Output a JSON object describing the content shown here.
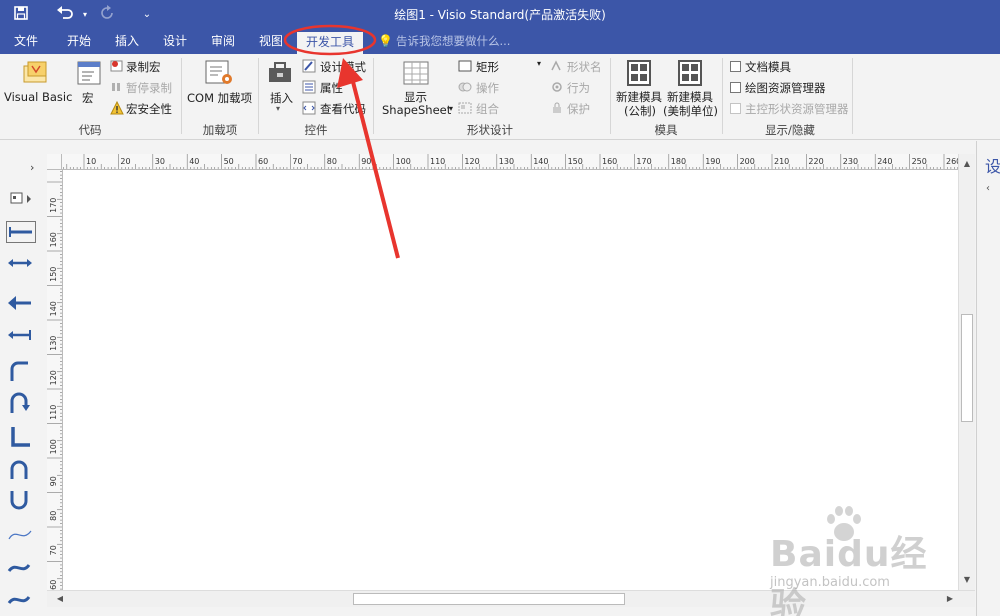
{
  "window": {
    "title": "绘图1 - Visio Standard(产品激活失败)"
  },
  "quick_access": {
    "save": "save-icon",
    "undo": "undo-icon",
    "redo": "redo-icon",
    "customize": "customize-icon"
  },
  "tabs": [
    {
      "label": "文件"
    },
    {
      "label": "开始"
    },
    {
      "label": "插入"
    },
    {
      "label": "设计"
    },
    {
      "label": "审阅"
    },
    {
      "label": "视图"
    },
    {
      "label": "开发工具",
      "active": true
    }
  ],
  "tell_me": {
    "placeholder": "告诉我您想要做什么..."
  },
  "ribbon": {
    "code": {
      "label": "代码",
      "visual_basic": "Visual Basic",
      "macros": "宏",
      "record_macro": "录制宏",
      "pause_recording": "暂停录制",
      "macro_security": "宏安全性"
    },
    "addins": {
      "label": "加载项",
      "com_addins": "COM 加载项"
    },
    "controls": {
      "label": "控件",
      "insert": "插入",
      "design_mode": "设计模式",
      "properties": "属性",
      "view_code": "查看代码"
    },
    "shape_design": {
      "label": "形状设计",
      "show_shapesheet_1": "显示",
      "show_shapesheet_2": "ShapeSheet",
      "rectangle": "矩形",
      "operations": "操作",
      "group": "组合",
      "shape_name": "形状名",
      "behavior": "行为",
      "protection": "保护"
    },
    "stencil": {
      "label": "模具",
      "new_metric_1": "新建模具",
      "new_metric_2": "(公制)",
      "new_us_1": "新建模具",
      "new_us_2": "(美制单位)"
    },
    "show_hide": {
      "label": "显示/隐藏",
      "document_stencil": "文档模具",
      "drawing_explorer": "绘图资源管理器",
      "master_explorer": "主控形状资源管理器"
    }
  },
  "rulers": {
    "horizontal": [
      "10",
      "20",
      "30",
      "40",
      "50",
      "60",
      "70",
      "80",
      "90",
      "100",
      "110",
      "120",
      "130",
      "140",
      "150",
      "160",
      "170",
      "180",
      "190",
      "200",
      "210",
      "220",
      "230",
      "240",
      "250",
      "260"
    ],
    "vertical": [
      "170",
      "160",
      "150",
      "140",
      "130",
      "120",
      "110",
      "100",
      "90",
      "80",
      "70",
      "60"
    ]
  },
  "right_panel": {
    "title_char": "设"
  },
  "watermark": {
    "brand": "Baidu经验",
    "url": "jingyan.baidu.com"
  },
  "colors": {
    "accent": "#3c56a8",
    "annotation": "#e8352e"
  }
}
